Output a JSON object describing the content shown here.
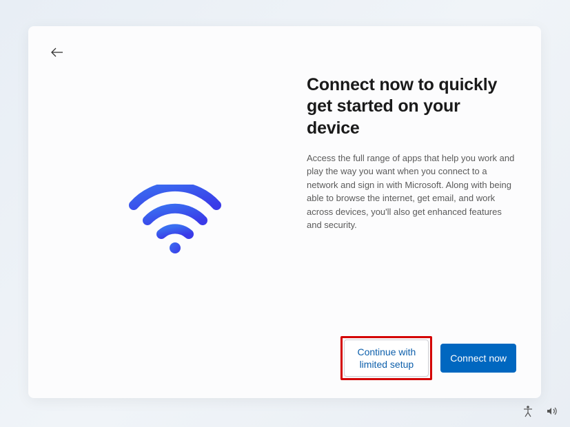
{
  "heading": "Connect now to quickly get started on your device",
  "description": "Access the full range of apps that help you work and play the way you want when you connect to a network and sign in with Microsoft. Along with being able to browse the internet, get email, and work across devices, you'll also get enhanced features and security.",
  "buttons": {
    "secondary": "Continue with\nlimited setup",
    "primary": "Connect now"
  },
  "icons": {
    "back": "back-arrow",
    "wifi": "wifi-signal",
    "accessibility": "accessibility-figure",
    "sound": "volume-speaker"
  }
}
